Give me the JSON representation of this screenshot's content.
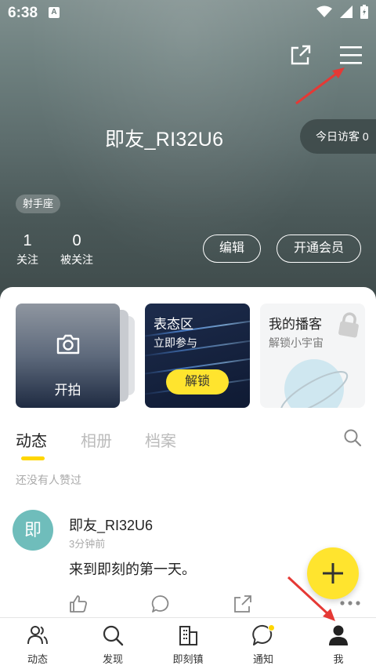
{
  "status_bar": {
    "time": "6:38",
    "notification_letter": "A"
  },
  "profile": {
    "username": "即友_RI32U6",
    "visitor_label": "今日访客 0",
    "zodiac": "射手座",
    "stats": [
      {
        "num": "1",
        "label": "关注"
      },
      {
        "num": "0",
        "label": "被关注"
      }
    ],
    "edit_label": "编辑",
    "vip_label": "开通会员"
  },
  "cards": {
    "shoot": {
      "label": "开拍"
    },
    "emoji": {
      "title": "表态区",
      "subtitle": "立即参与",
      "button": "解锁"
    },
    "podcast": {
      "title": "我的播客",
      "subtitle": "解锁小宇宙"
    }
  },
  "tabs": [
    "动态",
    "相册",
    "档案"
  ],
  "empty_likes": "还没有人赞过",
  "post": {
    "avatar_char": "即",
    "user": "即友_RI32U6",
    "time": "3分钟前",
    "body": "来到即刻的第一天。"
  },
  "bottom_nav": [
    {
      "label": "动态",
      "icon": "people-icon"
    },
    {
      "label": "发现",
      "icon": "search-icon"
    },
    {
      "label": "即刻镇",
      "icon": "buildings-icon"
    },
    {
      "label": "通知",
      "icon": "chat-bubble-icon"
    },
    {
      "label": "我",
      "icon": "person-icon"
    }
  ],
  "colors": {
    "accent": "#ffe42e",
    "avatar": "#6fbdbb",
    "annotation_arrow": "#e53935"
  }
}
